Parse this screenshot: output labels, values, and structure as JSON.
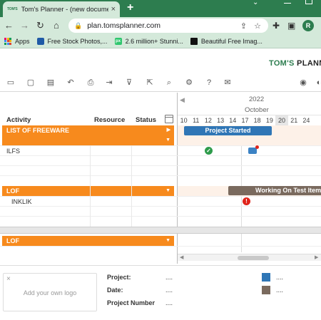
{
  "browser": {
    "tab_icon_text": "TOM'S",
    "tab_title": "Tom's Planner - (new document)",
    "tab_close": "×",
    "new_tab": "+",
    "url": "plan.tomsplanner.com",
    "profile_initial": "R",
    "bookmarks": [
      {
        "label": "Apps",
        "icon": "apps-grid-icon"
      },
      {
        "label": "Free Stock Photos,...",
        "icon": "bookmark-icon"
      },
      {
        "label": "2.6 million+ Stunni...",
        "icon": "pixabay-icon"
      },
      {
        "label": "Beautiful Free Imag...",
        "icon": "unsplash-icon"
      }
    ]
  },
  "app": {
    "logo_primary": "TOM'S",
    "logo_secondary": " PLANNER"
  },
  "grid": {
    "columns": {
      "activity": "Activity",
      "resource": "Resource",
      "status": "Status"
    },
    "year": "2022",
    "month": "October",
    "days": [
      "10",
      "11",
      "12",
      "13",
      "14",
      "17",
      "18",
      "19",
      "20",
      "21",
      "24"
    ],
    "highlighted_day": "20",
    "groups": [
      {
        "label": "LIST OF FREEWARE",
        "bar_label": "Project Started",
        "bar_color": "#2f76b6"
      },
      {
        "label": "LOF",
        "bar_label": "Working On Test Items",
        "bar_color": "#7a6a5e"
      },
      {
        "label": "LOF"
      }
    ],
    "tasks": [
      {
        "label": "ILFS"
      },
      {
        "label": "INKLIK"
      }
    ],
    "group_color": "#f78a1d"
  },
  "footer": {
    "logo_placeholder": "Add your own logo",
    "logo_close": "×",
    "fields": [
      {
        "label": "Project:",
        "value": "...."
      },
      {
        "label": "Date:",
        "value": "...."
      },
      {
        "label": "Project Number",
        "value": "...."
      }
    ],
    "legend": [
      {
        "color": "#2f76b6",
        "value": "...."
      },
      {
        "color": "#7a6a5e",
        "value": "...."
      }
    ]
  }
}
